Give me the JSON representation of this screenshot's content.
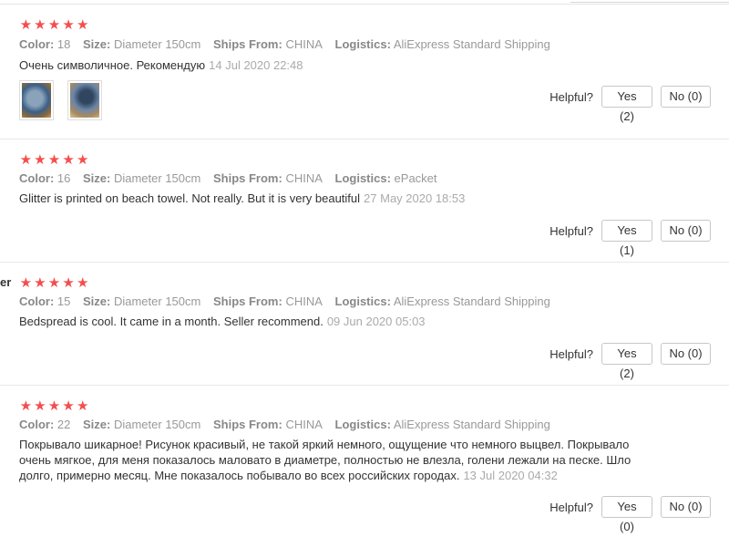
{
  "labels": {
    "color": "Color:",
    "size": "Size:",
    "ships_from": "Ships From:",
    "logistics": "Logistics:",
    "helpful": "Helpful?"
  },
  "rating_icon": "star-icon",
  "star_color": "#f44e4e",
  "side_label": "er",
  "reviews": [
    {
      "stars": 5,
      "color": "18",
      "size": "Diameter 150cm",
      "ships_from": "CHINA",
      "logistics": "AliExpress Standard Shipping",
      "text": "Очень символичное. Рекомендую",
      "date": "14 Jul 2020 22:48",
      "yes": "Yes (2)",
      "no": "No (0)"
    },
    {
      "stars": 5,
      "color": "16",
      "size": "Diameter 150cm",
      "ships_from": "CHINA",
      "logistics": "ePacket",
      "text": "Glitter is printed on beach towel. Not really. But it is very beautiful",
      "date": "27 May 2020 18:53",
      "yes": "Yes (1)",
      "no": "No (0)"
    },
    {
      "stars": 5,
      "color": "15",
      "size": "Diameter 150cm",
      "ships_from": "CHINA",
      "logistics": "AliExpress Standard Shipping",
      "text": "Bedspread is cool. It came in a month. Seller recommend.",
      "date": "09 Jun 2020 05:03",
      "yes": "Yes (2)",
      "no": "No (0)"
    },
    {
      "stars": 5,
      "color": "22",
      "size": "Diameter 150cm",
      "ships_from": "CHINA",
      "logistics": "AliExpress Standard Shipping",
      "text_lines": [
        "Покрывало шикарное! Рисунок красивый, не такой яркий немного, ощущение что немного выцвел. Покрывало",
        "очень мягкое, для меня показалось маловато в диаметре, полностью не влезла, голени лежали на песке. Шло",
        "долго, примерно месяц. Мне показалось побывало во всех российских городах."
      ],
      "date": "13 Jul 2020 04:32",
      "yes": "Yes (0)",
      "no": "No (0)"
    }
  ]
}
